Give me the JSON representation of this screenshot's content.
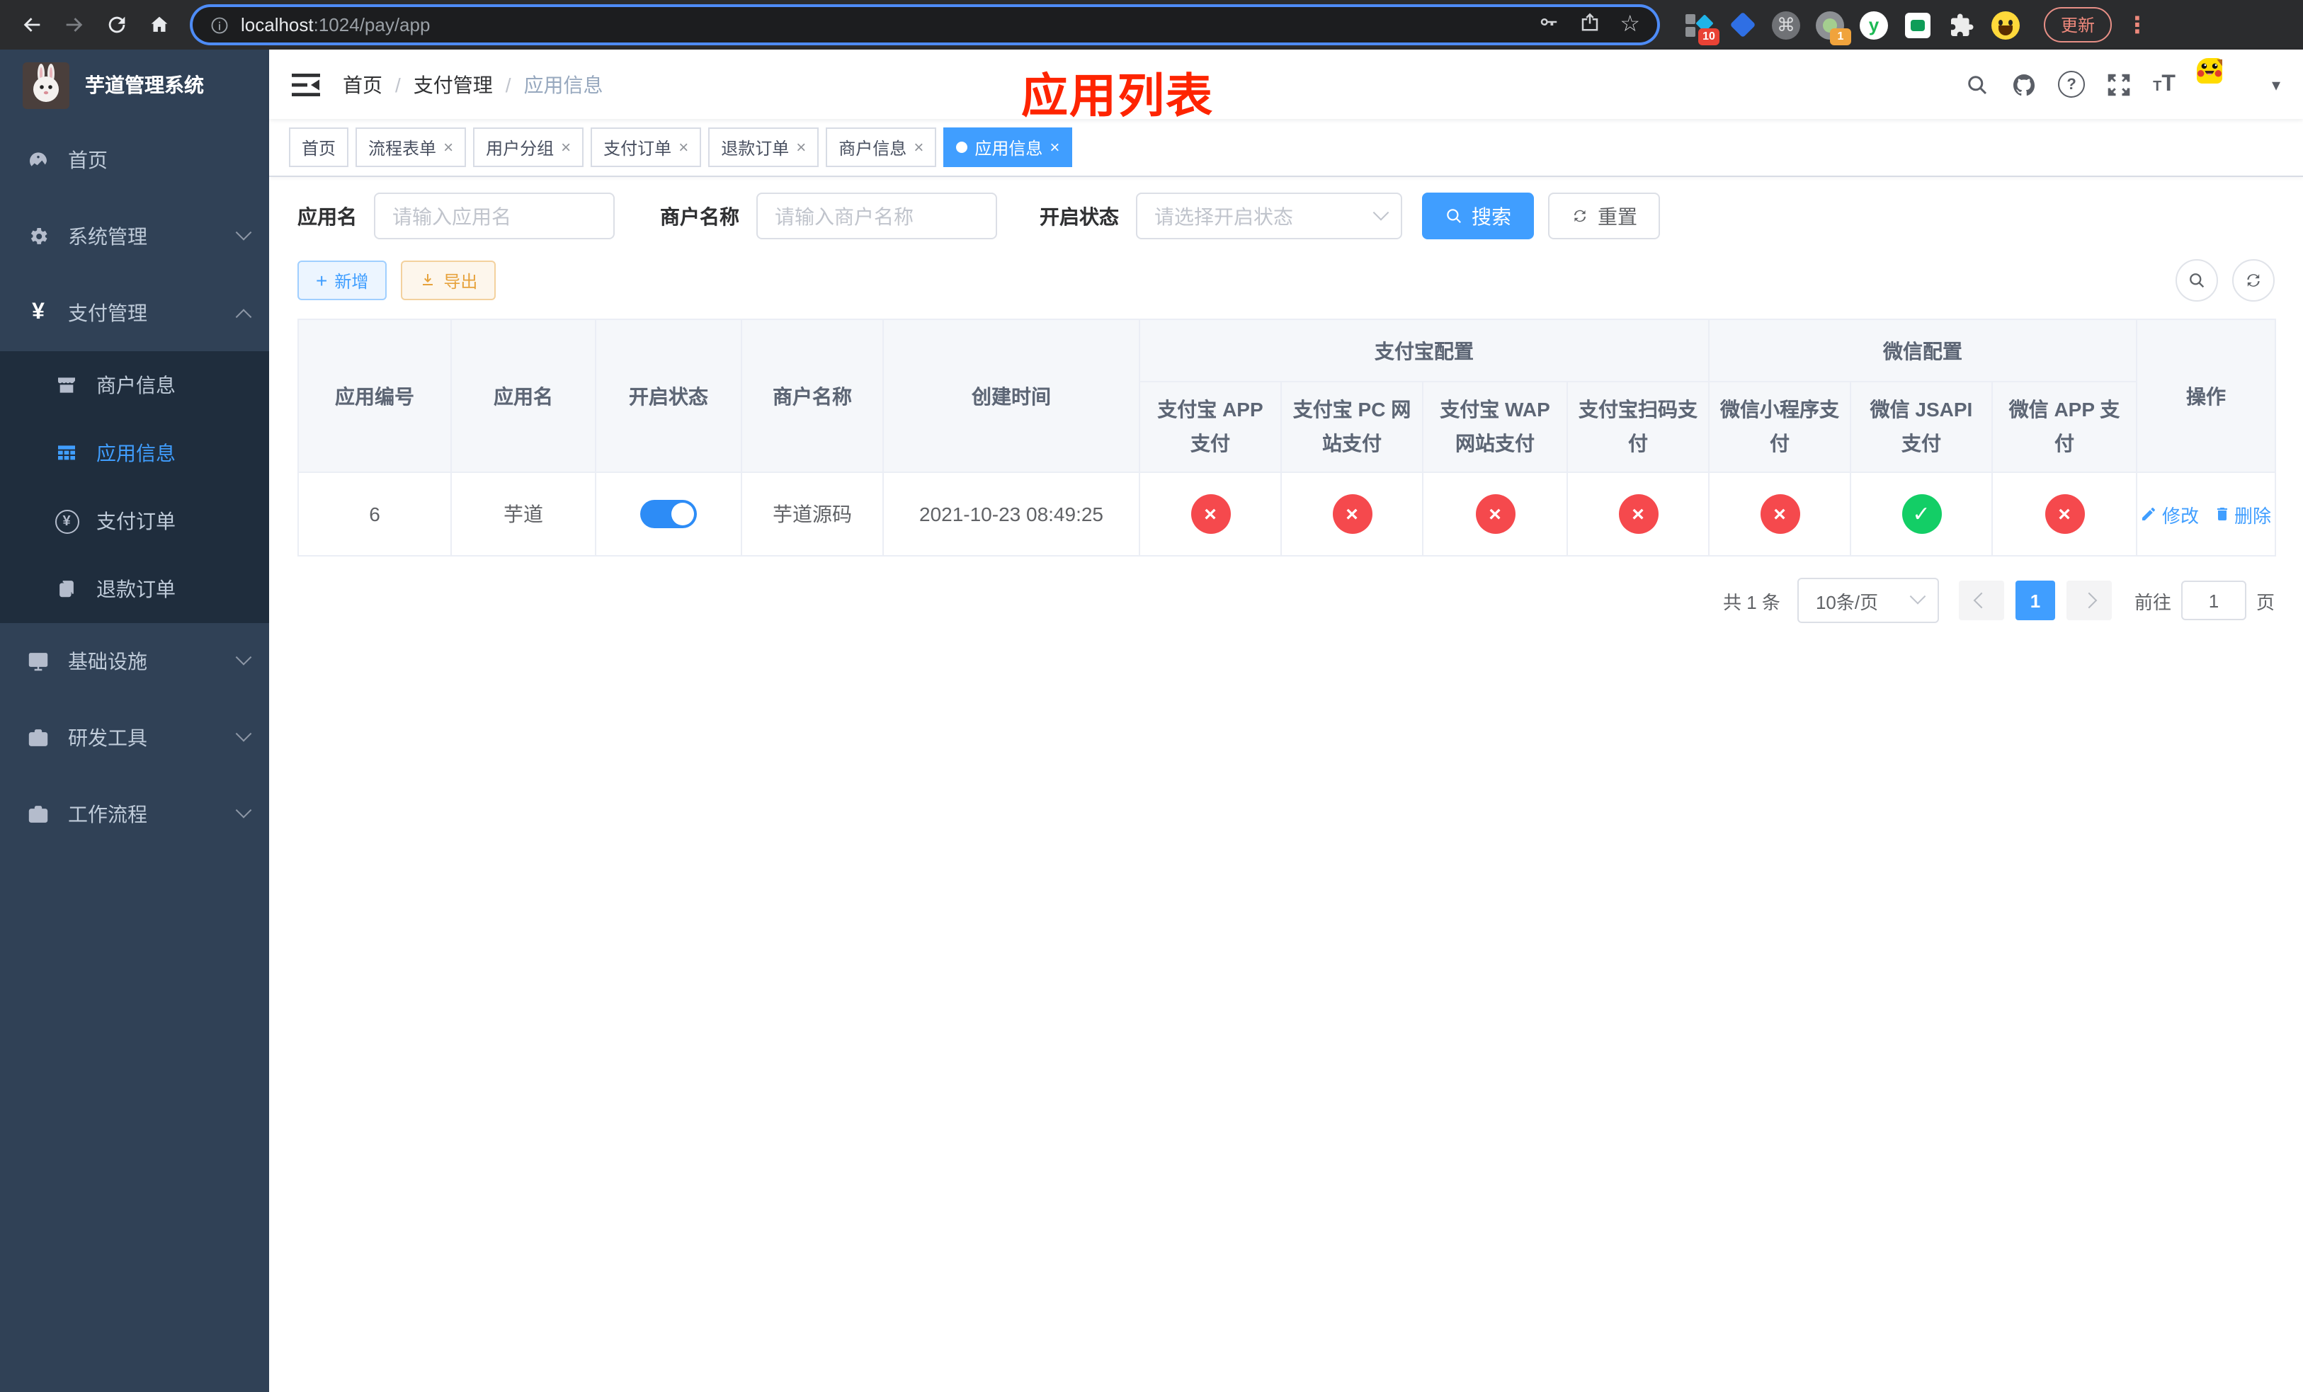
{
  "colors": {
    "accent": "#409eff",
    "annotation_red": "#fe2400",
    "success_green": "#13ce66",
    "danger_red": "#f5494d",
    "sidebar_bg": "#304156",
    "submenu_bg": "#1f2d3d",
    "toggle_on_blue": "#2d8cf6"
  },
  "browser": {
    "url_host": "localhost",
    "url_path": ":1024/pay/app",
    "ext_badge_blocks": "10",
    "ext_badge_record": "1",
    "ext_y": "y",
    "update_label": "更新"
  },
  "sidebar": {
    "title": "芋道管理系统",
    "items": [
      {
        "label": "首页",
        "icon": "dashboard-icon"
      },
      {
        "label": "系统管理",
        "icon": "gear-icon",
        "chevron": "down"
      },
      {
        "label": "支付管理",
        "icon": "yen-icon",
        "chevron": "up"
      },
      {
        "label": "商户信息",
        "icon": "shop-icon"
      },
      {
        "label": "应用信息",
        "icon": "grid-icon",
        "active": true
      },
      {
        "label": "支付订单",
        "icon": "yen-circle-icon"
      },
      {
        "label": "退款订单",
        "icon": "document-icon"
      },
      {
        "label": "基础设施",
        "icon": "monitor-icon",
        "chevron": "down"
      },
      {
        "label": "研发工具",
        "icon": "toolbox-icon",
        "chevron": "down"
      },
      {
        "label": "工作流程",
        "icon": "briefcase-icon",
        "chevron": "down"
      }
    ]
  },
  "header": {
    "breadcrumb": [
      "首页",
      "支付管理",
      "应用信息"
    ],
    "annotation": "应用列表"
  },
  "tabs": [
    {
      "label": "首页",
      "closable": false,
      "active": false
    },
    {
      "label": "流程表单",
      "closable": true,
      "active": false
    },
    {
      "label": "用户分组",
      "closable": true,
      "active": false
    },
    {
      "label": "支付订单",
      "closable": true,
      "active": false
    },
    {
      "label": "退款订单",
      "closable": true,
      "active": false
    },
    {
      "label": "商户信息",
      "closable": true,
      "active": false
    },
    {
      "label": "应用信息",
      "closable": true,
      "active": true
    }
  ],
  "filters": {
    "app_name_label": "应用名",
    "app_name_placeholder": "请输入应用名",
    "merchant_label": "商户名称",
    "merchant_placeholder": "请输入商户名称",
    "status_label": "开启状态",
    "status_placeholder": "请选择开启状态",
    "search_label": "搜索",
    "reset_label": "重置"
  },
  "toolbar": {
    "add_label": "新增",
    "export_label": "导出"
  },
  "table": {
    "col_app_id": "应用编号",
    "col_app_name": "应用名",
    "col_status": "开启状态",
    "col_merchant": "商户名称",
    "col_create_time": "创建时间",
    "group_alipay": "支付宝配置",
    "group_wechat": "微信配置",
    "col_op": "操作",
    "channel_cols": [
      "支付宝 APP 支付",
      "支付宝 PC 网站支付",
      "支付宝 WAP 网站支付",
      "支付宝扫码支付",
      "微信小程序支付",
      "微信 JSAPI 支付",
      "微信 APP 支付"
    ],
    "row": {
      "app_id": "6",
      "app_name": "芋道",
      "switch": "on",
      "merchant": "芋道源码",
      "create_time": "2021-10-23 08:49:25",
      "channels": [
        "disabled",
        "disabled",
        "disabled",
        "disabled",
        "disabled",
        "enabled",
        "disabled"
      ],
      "edit_label": "修改",
      "delete_label": "删除"
    }
  },
  "pagination": {
    "total": "共 1 条",
    "page_size": "10条/页",
    "page": "1",
    "goto_label": "前往",
    "goto_value": "1",
    "unit_label": "页"
  }
}
